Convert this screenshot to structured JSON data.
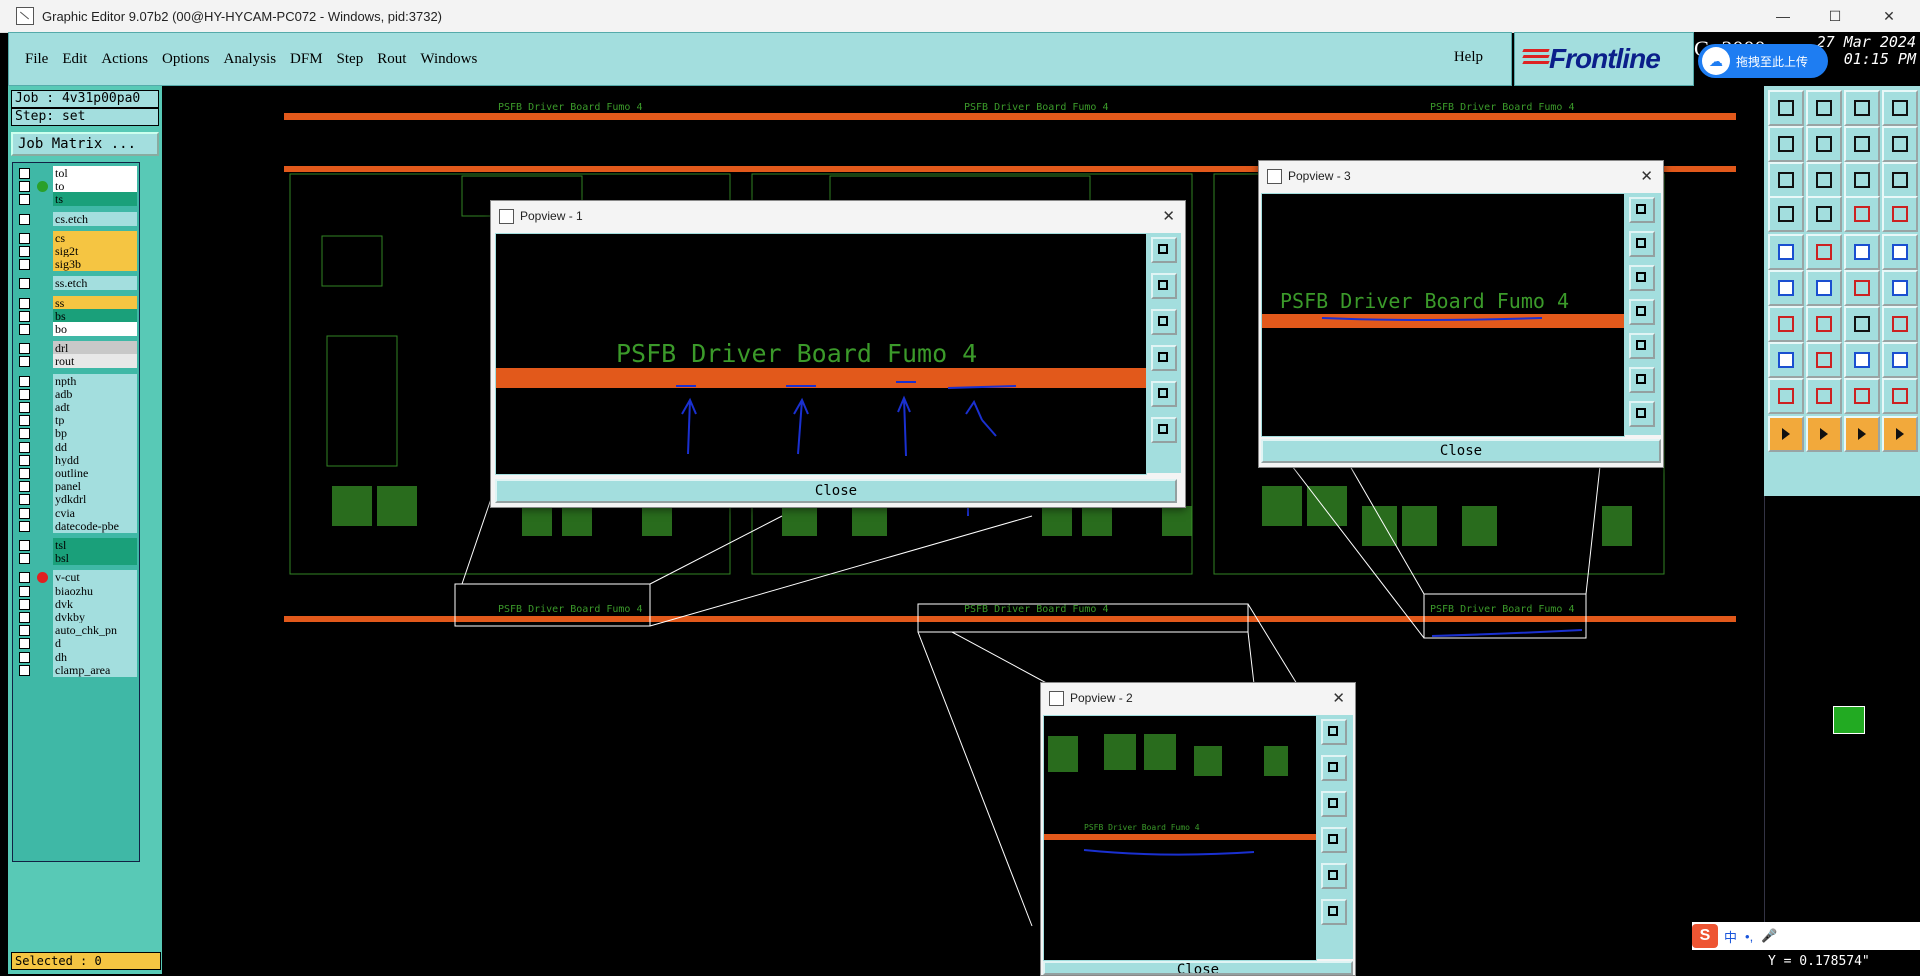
{
  "window": {
    "title": "Graphic Editor 9.07b2 (00@HY-HYCAM-PC072 - Windows, pid:3732)",
    "minimize": "—",
    "maximize": "☐",
    "close": "✕"
  },
  "menu": {
    "items": [
      "File",
      "Edit",
      "Actions",
      "Options",
      "Analysis",
      "DFM",
      "Step",
      "Rout",
      "Windows"
    ],
    "help": "Help"
  },
  "brand": {
    "logo": "Frontline",
    "clock_g": "G",
    "clock_year": ": 2000",
    "clock_date": "27 Mar 2024",
    "clock_time": "01:15 PM"
  },
  "upload_widget": {
    "label": "拖拽至此上传"
  },
  "left": {
    "job": "Job : 4v31p00pa0",
    "step": "Step: set",
    "job_matrix": "Job Matrix ...",
    "selected": "Selected : 0",
    "layers": [
      {
        "name": "tol",
        "color": "#ffffff",
        "dot": ""
      },
      {
        "name": "to",
        "color": "#ffffff",
        "dot": "#2aa02a"
      },
      {
        "name": "ts",
        "color": "#1aa07a",
        "dot": ""
      },
      {
        "name": "cs.etch",
        "color": "#a3dede",
        "dot": "",
        "gap": true
      },
      {
        "name": "cs",
        "color": "#f5c542",
        "dot": "",
        "gap": true
      },
      {
        "name": "sig2t",
        "color": "#f5c542",
        "dot": ""
      },
      {
        "name": "sig3b",
        "color": "#f5c542",
        "dot": ""
      },
      {
        "name": "ss.etch",
        "color": "#a3dede",
        "dot": "",
        "gap": true
      },
      {
        "name": "ss",
        "color": "#f5c542",
        "dot": "",
        "gap": true
      },
      {
        "name": "bs",
        "color": "#1aa07a",
        "dot": ""
      },
      {
        "name": "bo",
        "color": "#ffffff",
        "dot": ""
      },
      {
        "name": "drl",
        "color": "#c8c8c8",
        "dot": "",
        "gap": true
      },
      {
        "name": "rout",
        "color": "#e8e8e8",
        "dot": ""
      },
      {
        "name": "npth",
        "color": "#a3dede",
        "dot": "",
        "gap": true
      },
      {
        "name": "adb",
        "color": "#a3dede",
        "dot": ""
      },
      {
        "name": "adt",
        "color": "#a3dede",
        "dot": ""
      },
      {
        "name": "tp",
        "color": "#a3dede",
        "dot": ""
      },
      {
        "name": "bp",
        "color": "#a3dede",
        "dot": ""
      },
      {
        "name": "dd",
        "color": "#a3dede",
        "dot": ""
      },
      {
        "name": "hydd",
        "color": "#a3dede",
        "dot": ""
      },
      {
        "name": "outline",
        "color": "#a3dede",
        "dot": ""
      },
      {
        "name": "panel",
        "color": "#a3dede",
        "dot": ""
      },
      {
        "name": "ydkdrl",
        "color": "#a3dede",
        "dot": ""
      },
      {
        "name": "cvia",
        "color": "#a3dede",
        "dot": ""
      },
      {
        "name": "datecode-pbe",
        "color": "#a3dede",
        "dot": ""
      },
      {
        "name": "tsl",
        "color": "#1aa07a",
        "dot": "",
        "gap": true
      },
      {
        "name": "bsl",
        "color": "#1aa07a",
        "dot": ""
      },
      {
        "name": "v-cut",
        "color": "#a3dede",
        "dot": "#e02020",
        "gap": true
      },
      {
        "name": "biaozhu",
        "color": "#a3dede",
        "dot": ""
      },
      {
        "name": "dvk",
        "color": "#a3dede",
        "dot": ""
      },
      {
        "name": "dvkby",
        "color": "#a3dede",
        "dot": ""
      },
      {
        "name": "auto_chk_pn",
        "color": "#a3dede",
        "dot": ""
      },
      {
        "name": "d",
        "color": "#a3dede",
        "dot": ""
      },
      {
        "name": "dh",
        "color": "#a3dede",
        "dot": ""
      },
      {
        "name": "clamp_area",
        "color": "#a3dede",
        "dot": ""
      }
    ]
  },
  "board": {
    "label": "PSFB Driver Board Fumo 4",
    "strip_color": "#e2591b",
    "trace_color": "#3b9a2a"
  },
  "popups": [
    {
      "title": "Popview - 1",
      "close": "Close",
      "label": "PSFB Driver Board Fumo 4"
    },
    {
      "title": "Popview - 3",
      "close": "Close",
      "label": "PSFB Driver Board Fumo 4"
    },
    {
      "title": "Popview - 2",
      "close": "Close",
      "label": "PSFB Driver Board Fumo 4"
    }
  ],
  "status": {
    "coord": "Y = 0.178574\""
  },
  "ime": {
    "lang": "中",
    "punct": "•,",
    "mic": "🎤"
  }
}
